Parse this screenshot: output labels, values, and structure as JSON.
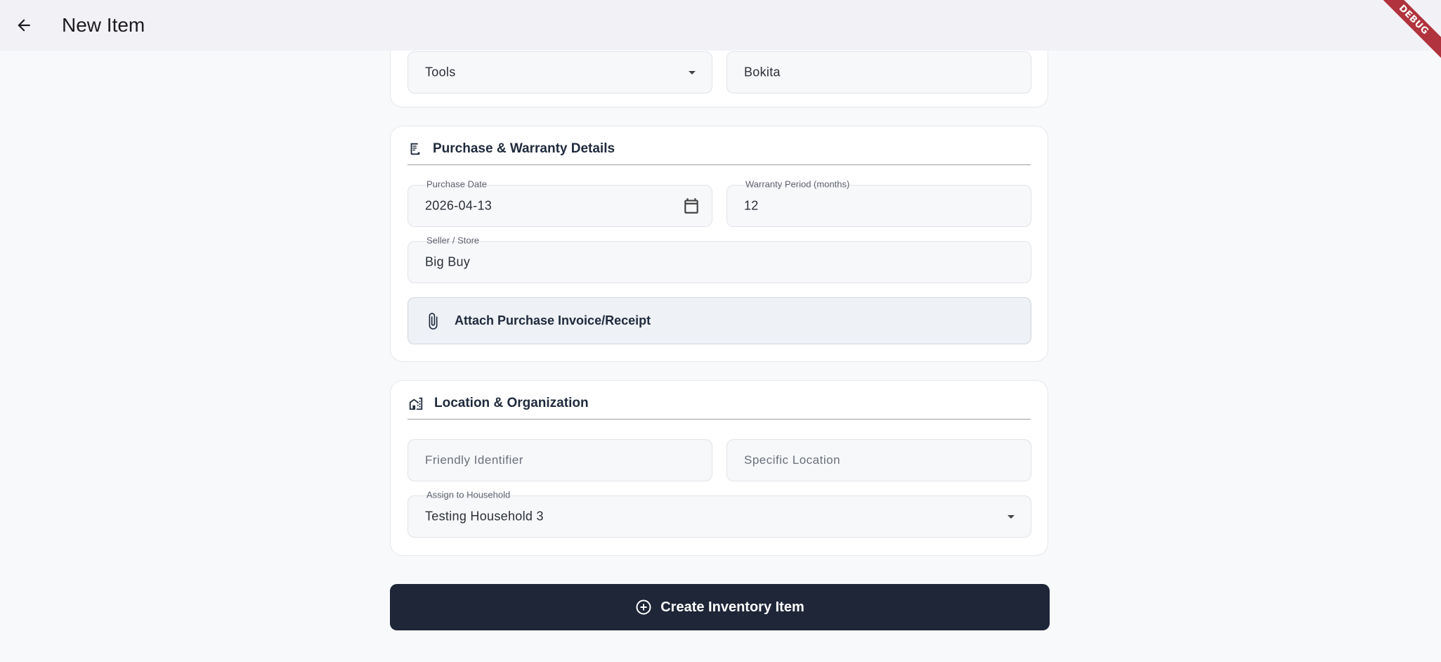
{
  "appbar": {
    "title": "New Item",
    "debug_label": "DEBUG"
  },
  "basic": {
    "category": {
      "value": "Tools"
    },
    "manufacturer": {
      "value": "Bokita"
    }
  },
  "purchase": {
    "section_title": "Purchase & Warranty Details",
    "purchase_date": {
      "label": "Purchase Date",
      "value": "2026-04-13"
    },
    "warranty_period": {
      "label": "Warranty Period (months)",
      "value": "12"
    },
    "seller": {
      "label": "Seller / Store",
      "value": "Big Buy"
    },
    "attach_label": "Attach Purchase Invoice/Receipt"
  },
  "location": {
    "section_title": "Location & Organization",
    "friendly_identifier": {
      "placeholder": "Friendly Identifier"
    },
    "specific_location": {
      "placeholder": "Specific Location"
    },
    "household": {
      "label": "Assign to Household",
      "value": "Testing Household 3"
    }
  },
  "create_button": {
    "label": "Create Inventory Item"
  },
  "icons": {
    "back": "arrow-left-icon",
    "dropdown": "dropdown-arrow-icon",
    "receipt": "receipt-icon",
    "calendar": "calendar-icon",
    "attach": "paperclip-icon",
    "location": "buildings-icon",
    "create": "add-circle-icon"
  },
  "colors": {
    "primary": "#1e2638",
    "background": "#f8f9fb",
    "appbar": "#f2f1f6",
    "debug_banner": "#b0333d"
  }
}
